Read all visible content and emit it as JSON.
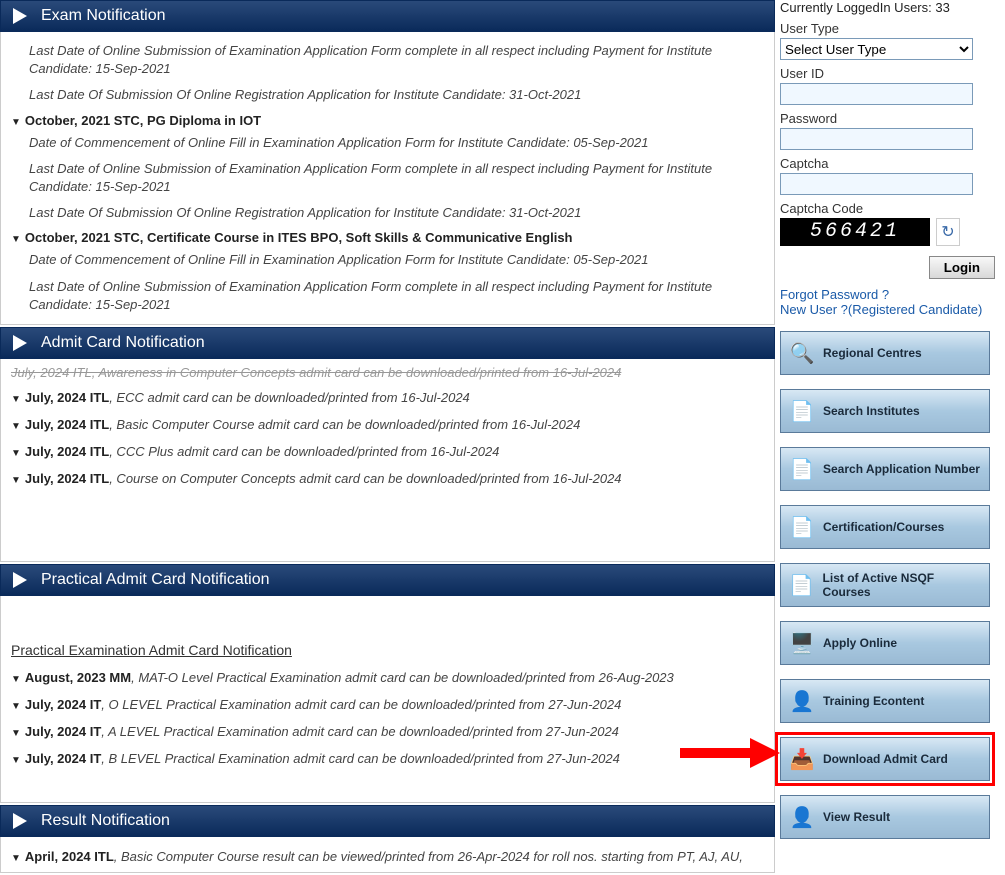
{
  "sections": {
    "exam": {
      "title": "Exam Notification"
    },
    "admit": {
      "title": "Admit Card Notification"
    },
    "practical": {
      "title": "Practical Admit Card Notification"
    },
    "result": {
      "title": "Result Notification"
    }
  },
  "exam_items": {
    "line0a": "Last Date of Online Submission of Examination Application Form complete in all respect including Payment for Institute Candidate: 15-Sep-2021",
    "line0b": "Last Date Of Submission Of Online Registration Application for Institute Candidate: 31-Oct-2021",
    "head1": "October, 2021 STC, PG Diploma in IOT",
    "line1a": "Date of Commencement of Online Fill in Examination Application Form for Institute Candidate: 05-Sep-2021",
    "line1b": "Last Date of Online Submission of Examination Application Form complete in all respect including Payment for Institute Candidate: 15-Sep-2021",
    "line1c": "Last Date Of Submission Of Online Registration Application for Institute Candidate: 31-Oct-2021",
    "head2": "October, 2021 STC, Certificate Course in ITES BPO, Soft Skills & Communicative English",
    "line2a": "Date of Commencement of Online Fill in Examination Application Form for Institute Candidate: 05-Sep-2021",
    "line2b": "Last Date of Online Submission of Examination Application Form complete in all respect including Payment for Institute Candidate: 15-Sep-2021"
  },
  "admit_items": {
    "cut": "July, 2024 ITL, Awareness in Computer Concepts admit card can be downloaded/printed from 16-Jul-2024",
    "r1b": "July, 2024 ITL",
    "r1t": ", ECC admit card can be downloaded/printed from 16-Jul-2024",
    "r2b": "July, 2024 ITL",
    "r2t": ", Basic Computer Course admit card can be downloaded/printed from 16-Jul-2024",
    "r3b": "July, 2024 ITL",
    "r3t": ", CCC Plus admit card can be downloaded/printed from 16-Jul-2024",
    "r4b": "July, 2024 ITL",
    "r4t": ", Course on Computer Concepts admit card can be downloaded/printed from 16-Jul-2024"
  },
  "practical_items": {
    "subhead": "Practical Examination Admit Card Notification",
    "r1b": "August, 2023 MM",
    "r1t": ", MAT-O Level Practical Examination admit card can be downloaded/printed from 26-Aug-2023",
    "r2b": "July, 2024 IT",
    "r2t": ", O LEVEL Practical Examination admit card can be downloaded/printed from 27-Jun-2024",
    "r3b": "July, 2024 IT",
    "r3t": ", A LEVEL Practical Examination admit card can be downloaded/printed from 27-Jun-2024",
    "r4b": "July, 2024 IT",
    "r4t": ", B LEVEL Practical Examination admit card can be downloaded/printed from 27-Jun-2024"
  },
  "result_items": {
    "r1b": "April, 2024 ITL",
    "r1t": ", Basic Computer Course result can be viewed/printed from 26-Apr-2024 for roll nos. starting from PT, AJ, AU,"
  },
  "login": {
    "logged_in": "Currently LoggedIn Users: 33",
    "user_type_label": "User Type",
    "user_type_opt": "Select User Type",
    "user_id_label": "User ID",
    "password_label": "Password",
    "captcha_label": "Captcha",
    "captcha_code_label": "Captcha Code",
    "captcha_value": "566421",
    "login_btn": "Login",
    "forgot": "Forgot Password ?",
    "newuser": "New User ?(Registered Candidate)"
  },
  "nav": {
    "regional": "Regional Centres",
    "search_inst": "Search Institutes",
    "search_app": "Search Application Number",
    "cert": "Certification/Courses",
    "nsqf": "List of Active NSQF Courses",
    "apply": "Apply Online",
    "training": "Training Econtent",
    "download": "Download Admit Card",
    "result": "View Result"
  }
}
